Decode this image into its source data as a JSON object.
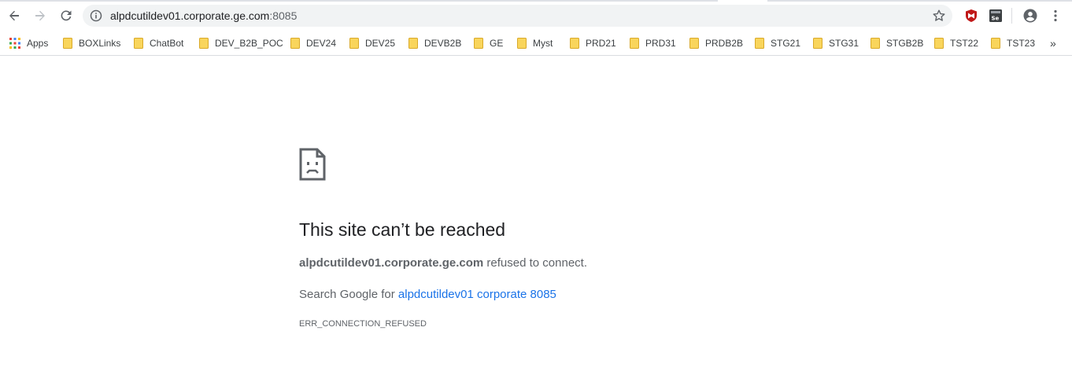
{
  "toolbar": {
    "back_icon": "back-arrow-icon",
    "forward_icon": "forward-arrow-icon",
    "reload_icon": "reload-icon",
    "url_host": "alpdcutildev01.corporate.ge.com",
    "url_port": ":8085",
    "star_icon": "star-icon",
    "extensions": [
      "mcafee-shield-icon",
      "selenium-ide-icon"
    ],
    "profile_icon": "profile-icon",
    "menu_icon": "kebab-menu-icon"
  },
  "bookmarks": {
    "apps_label": "Apps",
    "items": [
      "BOXLinks",
      "ChatBot",
      "DEV_B2B_POC",
      "DEV24",
      "DEV25",
      "DEVB2B",
      "GE",
      "Myst",
      "PRD21",
      "PRD31",
      "PRDB2B",
      "STG21",
      "STG31",
      "STGB2B",
      "TST22",
      "TST23"
    ],
    "overflow": "»"
  },
  "error": {
    "icon": "sad-page-icon",
    "title": "This site can’t be reached",
    "host": "alpdcutildev01.corporate.ge.com",
    "refused_text": " refused to connect.",
    "search_prefix": "Search Google for ",
    "search_link": "alpdcutildev01 corporate 8085",
    "code": "ERR_CONNECTION_REFUSED"
  },
  "colors": {
    "link": "#1a73e8",
    "text_primary": "#202124",
    "text_secondary": "#5f6368",
    "folder": "#f9d55c",
    "mcafee": "#c01818"
  }
}
